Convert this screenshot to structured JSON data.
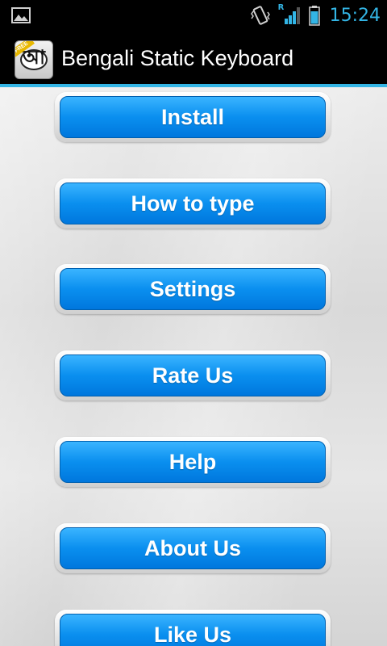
{
  "status_bar": {
    "time": "15:24",
    "accent_color": "#33b5e5",
    "icons": [
      "image-notification-icon",
      "vibrate-icon",
      "roaming-icon",
      "signal-icon",
      "battery-icon"
    ],
    "roaming_label": "R"
  },
  "app_bar": {
    "title": "Bengali Static Keyboard",
    "icon_glyph": "আ",
    "icon_ribbon": "FREE"
  },
  "menu": {
    "buttons": [
      {
        "label": "Install"
      },
      {
        "label": "How to type"
      },
      {
        "label": "Settings"
      },
      {
        "label": "Rate Us"
      },
      {
        "label": "Help"
      },
      {
        "label": "About Us"
      },
      {
        "label": "Like Us"
      }
    ],
    "button_color": "#0a8fef"
  }
}
